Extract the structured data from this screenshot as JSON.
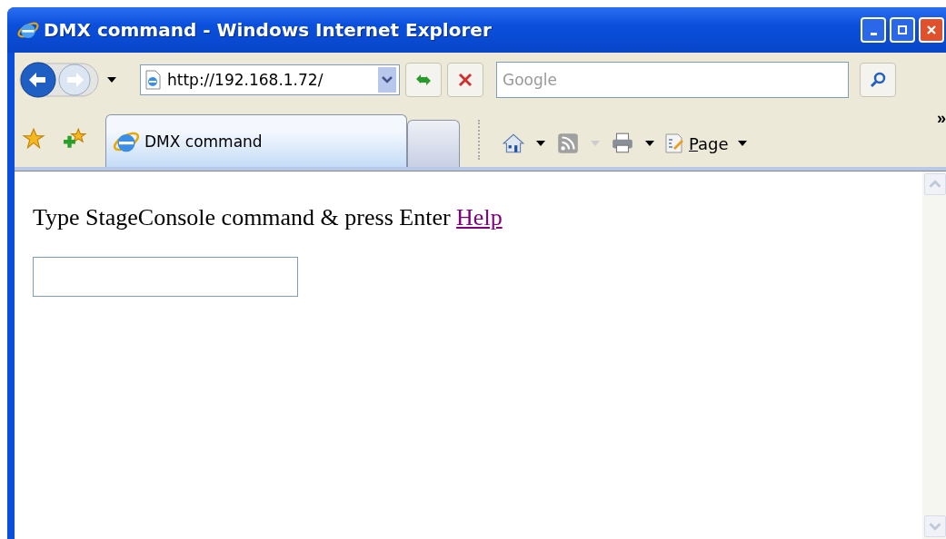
{
  "window": {
    "title": "DMX command - Windows Internet Explorer"
  },
  "address_bar": {
    "value": "http://192.168.1.72/"
  },
  "search": {
    "placeholder": "Google"
  },
  "tabs": [
    {
      "label": "DMX command",
      "selected": true
    }
  ],
  "command_bar": {
    "page_menu": "Page",
    "overflow": "»"
  },
  "content": {
    "instruction": "Type StageConsole command & press Enter",
    "help_link": "Help"
  }
}
